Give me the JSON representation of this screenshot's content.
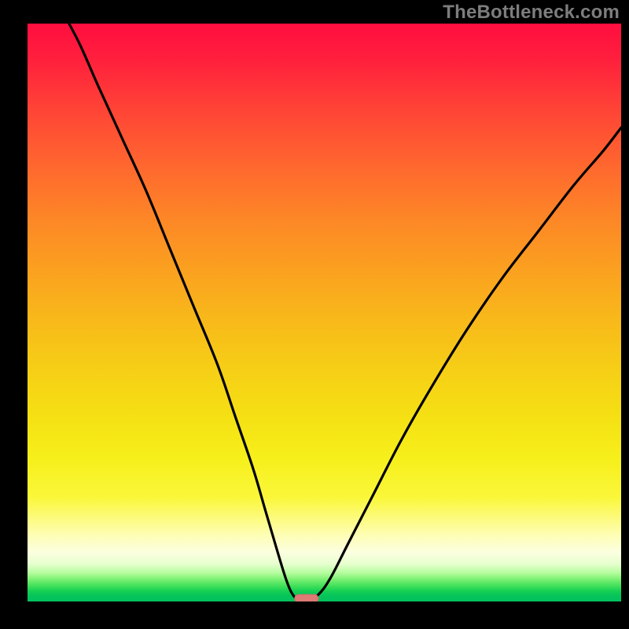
{
  "watermark": "TheBottleneck.com",
  "chart_data": {
    "type": "line",
    "title": "",
    "xlabel": "",
    "ylabel": "",
    "xlim": [
      0,
      100
    ],
    "ylim": [
      0,
      100
    ],
    "grid": false,
    "curve_points": [
      {
        "x": 7,
        "y": 100
      },
      {
        "x": 9,
        "y": 96
      },
      {
        "x": 12,
        "y": 89
      },
      {
        "x": 16,
        "y": 80
      },
      {
        "x": 20,
        "y": 71
      },
      {
        "x": 24,
        "y": 61
      },
      {
        "x": 28,
        "y": 51
      },
      {
        "x": 32,
        "y": 41
      },
      {
        "x": 35,
        "y": 32
      },
      {
        "x": 38,
        "y": 23
      },
      {
        "x": 40,
        "y": 16
      },
      {
        "x": 42,
        "y": 9
      },
      {
        "x": 43.5,
        "y": 4
      },
      {
        "x": 44.5,
        "y": 1.5
      },
      {
        "x": 45.5,
        "y": 0.5
      },
      {
        "x": 47.5,
        "y": 0.5
      },
      {
        "x": 49,
        "y": 1.2
      },
      {
        "x": 51,
        "y": 4
      },
      {
        "x": 54,
        "y": 10
      },
      {
        "x": 58,
        "y": 18
      },
      {
        "x": 63,
        "y": 28
      },
      {
        "x": 68,
        "y": 37
      },
      {
        "x": 74,
        "y": 47
      },
      {
        "x": 80,
        "y": 56
      },
      {
        "x": 86,
        "y": 64
      },
      {
        "x": 92,
        "y": 72
      },
      {
        "x": 97,
        "y": 78
      },
      {
        "x": 100,
        "y": 82
      }
    ],
    "marker": {
      "x": 47,
      "y": 0.5,
      "w": 4,
      "h": 1.4
    },
    "background_gradient": {
      "stops": [
        {
          "color": "#ff0e3f",
          "pct": 0
        },
        {
          "color": "#fb9f20",
          "pct": 42
        },
        {
          "color": "#f6ef1a",
          "pct": 75
        },
        {
          "color": "#fefeb5",
          "pct": 89
        },
        {
          "color": "#02c15e",
          "pct": 100
        }
      ]
    }
  }
}
